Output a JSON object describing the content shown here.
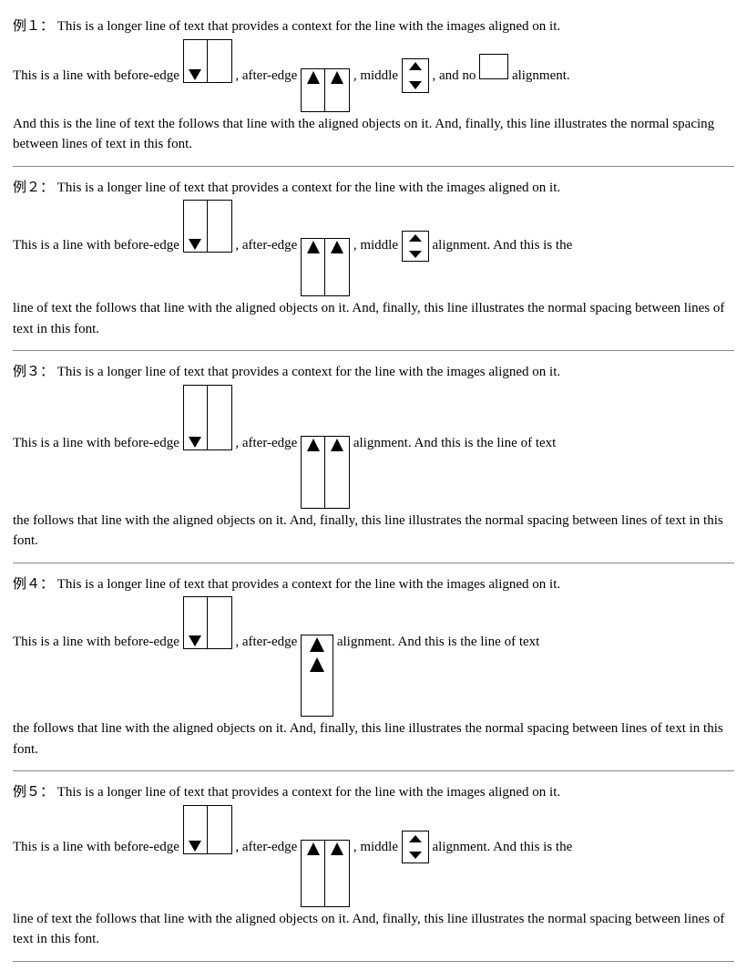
{
  "sections": [
    {
      "id": "ex1",
      "label": "例１：",
      "context_line": "This is a longer line of text that provides a context for the line with the images aligned on it.",
      "inline_line_before": "This is a line with before-edge ",
      "inline_label_after": ", after-edge",
      "inline_label_middle": ", middle",
      "inline_label_noalign": ", and no",
      "inline_label_end": " alignment.",
      "followup": "And this is the line of text the follows that line with the aligned objects on it. And, finally, this line illustrates the normal spacing between lines of text in this font."
    },
    {
      "id": "ex2",
      "label": "例２：",
      "context_line": "This is a longer line of text that provides a context for the line with the images aligned on it.",
      "inline_line_before": "This is a line with before-edge",
      "inline_label_after": ", after-edge",
      "inline_label_middle": ", middle",
      "inline_label_end": " alignment. And this is the",
      "followup": "line of text the follows that line with the aligned objects on it. And, finally, this line illustrates the normal spacing between lines of text in this font."
    },
    {
      "id": "ex3",
      "label": "例３：",
      "context_line": "This is a longer line of text that provides a context for the line with the images aligned on it.",
      "inline_line_before": "This is a line with before-edge",
      "inline_label_after": ", after-edge",
      "inline_label_end": " alignment. And this is the line of text",
      "followup": "the follows that line with the aligned objects on it. And, finally, this line illustrates the normal spacing between lines of text in this font."
    },
    {
      "id": "ex4",
      "label": "例４：",
      "context_line": "This is a longer line of text that provides a context for the line with the images aligned on it.",
      "inline_line_before": "This is a line with before-edge",
      "inline_label_after": ", after-edge",
      "inline_label_end": " alignment. And this is the line of text",
      "followup": "the follows that line with the aligned objects on it. And, finally, this line illustrates the normal spacing between lines of text in this font."
    },
    {
      "id": "ex5",
      "label": "例５：",
      "context_line": "This is a longer line of text that provides a context for the line with the images aligned on it.",
      "inline_line_before": "This is a line with before-edge",
      "inline_label_after": ", after-edge",
      "inline_label_middle": ", middle",
      "inline_label_end": " alignment. And this is the",
      "followup": "line of text the follows that line with the aligned objects on it. And, finally, this line illustrates the normal spacing between lines of text in this font."
    }
  ]
}
